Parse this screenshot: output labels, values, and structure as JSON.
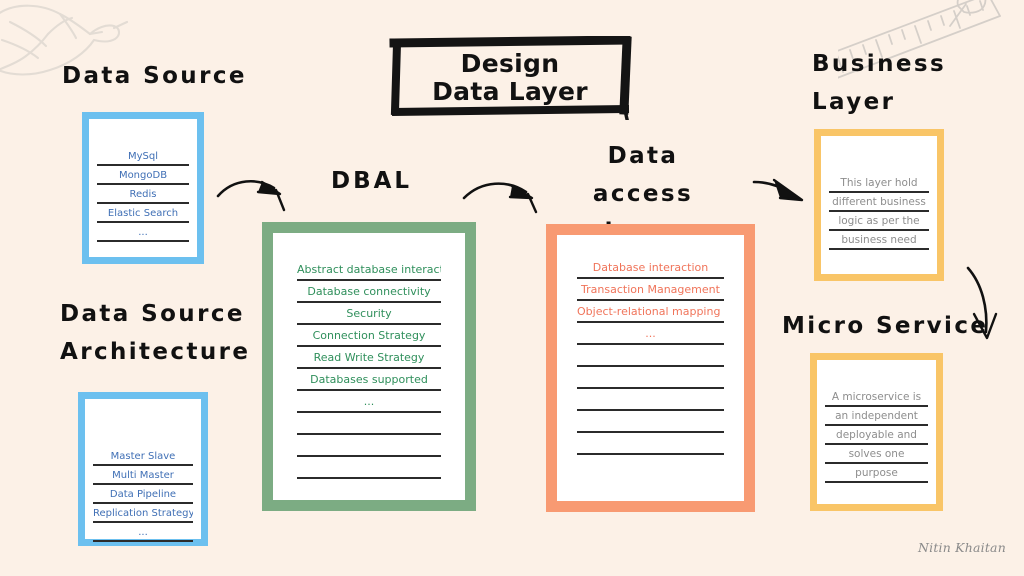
{
  "background_color": "#fcf1e7",
  "title": {
    "line1": "Design",
    "line2": "Data Layer"
  },
  "labels": {
    "data_source": "Data Source",
    "data_source_architecture": "Data Source\nArchitecture",
    "dbal": "DBAL",
    "data_access_layer": "Data access\nlayer",
    "business_layer": "Business\n   Layer",
    "micro_service": "Micro Service"
  },
  "cards": {
    "data_source": {
      "accent": "#6cc0ef",
      "text_color": "#3f6fb5",
      "items": [
        "MySql",
        "MongoDB",
        "Redis",
        "Elastic Search",
        "..."
      ]
    },
    "data_source_architecture": {
      "accent": "#6cc0ef",
      "text_color": "#3f6fb5",
      "items": [
        "Master Slave",
        "Multi Master",
        "Data Pipeline",
        "Replication Strategy",
        "..."
      ]
    },
    "dbal": {
      "accent": "#7cac83",
      "text_color": "#2f8f5b",
      "items": [
        "Abstract database interaction",
        "Database connectivity",
        "Security",
        "Connection Strategy",
        "Read Write Strategy",
        "Databases supported",
        "...",
        "",
        "",
        ""
      ]
    },
    "data_access_layer": {
      "accent": "#f89a72",
      "text_color": "#f0745a",
      "items": [
        "Database interaction",
        "Transaction Management",
        "Object-relational mapping (ORM)",
        "...",
        "",
        "",
        "",
        "",
        ""
      ]
    },
    "business_layer": {
      "accent": "#f9c567",
      "text_color": "#8d8d8d",
      "items": [
        "This layer hold",
        "different business",
        "logic as per the",
        "business need"
      ]
    },
    "micro_service": {
      "accent": "#f9c567",
      "text_color": "#8d8d8d",
      "items": [
        "A microservice is",
        "an independent",
        "deployable and",
        "solves one",
        "purpose"
      ]
    }
  },
  "arrows": {
    "data_source_to_dbal": "arrow-right-curved",
    "dbal_to_data_access": "arrow-right-curved",
    "data_access_to_business": "arrow-right-curved",
    "business_to_micro_service": "arrow-down-curved"
  },
  "decorations": {
    "bird": "bird-sketch",
    "ruler": "ruler-and-pin-sketch"
  },
  "signature": "Nitin Khaitan"
}
